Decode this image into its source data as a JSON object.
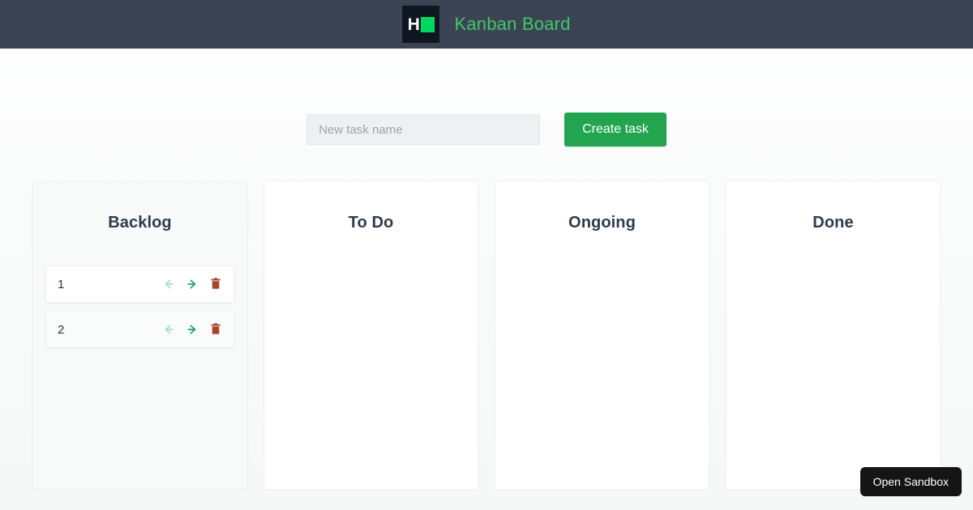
{
  "header": {
    "logo_letter": "H",
    "logo_square_icon": "green-square-icon",
    "title": "Kanban Board",
    "bar_color": "#3c4453",
    "title_color": "#3ec96a",
    "logo_bg": "#0f1720",
    "logo_square_color": "#00d95f"
  },
  "create_task": {
    "input_placeholder": "New task name",
    "input_value": "",
    "button_label": "Create task",
    "button_color": "#23a550"
  },
  "board": {
    "columns": [
      {
        "title": "Backlog",
        "tinted": true,
        "tasks": [
          {
            "label": "1",
            "move_left_icon": "arrow-left-icon",
            "move_left_enabled": false,
            "move_right_icon": "arrow-right-icon",
            "move_right_enabled": true,
            "delete_icon": "trash-icon"
          },
          {
            "label": "2",
            "move_left_icon": "arrow-left-icon",
            "move_left_enabled": false,
            "move_right_icon": "arrow-right-icon",
            "move_right_enabled": true,
            "delete_icon": "trash-icon"
          }
        ]
      },
      {
        "title": "To Do",
        "tinted": false,
        "tasks": []
      },
      {
        "title": "Ongoing",
        "tinted": false,
        "tasks": []
      },
      {
        "title": "Done",
        "tinted": false,
        "tasks": []
      }
    ],
    "icon_colors": {
      "arrow_disabled": "#a8ddc2",
      "arrow_enabled": "#1f9d72",
      "trash": "#a8442b"
    }
  },
  "sandbox": {
    "label": "Open Sandbox"
  }
}
